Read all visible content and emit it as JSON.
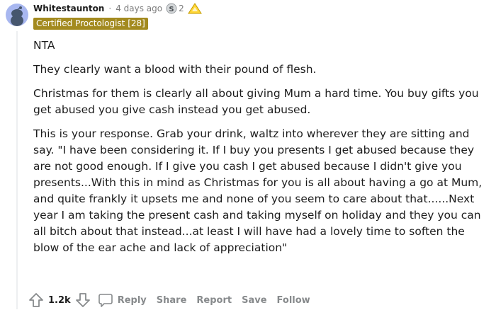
{
  "comment": {
    "username": "Whitestaunton",
    "separator": "·",
    "time": "4 days ago",
    "award_count": "2",
    "flair": "Certified Proctologist [28]",
    "paragraphs": [
      "NTA",
      "They clearly want a blood with their pound of flesh.",
      "Christmas for them is clearly all about giving Mum a hard time. You buy gifts you get abused you give cash instead you get abused.",
      "This is your response. Grab your drink, waltz into wherever they are sitting and say. \"I have been considering it. If I buy you presents I get abused because they are not good enough. If I give you cash I get abused because I didn't give you presents...With this in mind as Christmas for you is all about having a go at Mum, and quite frankly it upsets me and none of you seem to care about that......Next year I am taking the present cash and taking myself on holiday and they you can all bitch about that instead...at least I will have had a lovely time to soften the blow of the ear ache and lack of appreciation\""
    ]
  },
  "actions": {
    "score": "1.2k",
    "reply": "Reply",
    "share": "Share",
    "report": "Report",
    "save": "Save",
    "follow": "Follow"
  },
  "icons": {
    "avatar": "snoo-avatar-icon",
    "award1": "silver-award-icon",
    "award2": "helpful-award-icon",
    "upvote": "upvote-arrow-icon",
    "downvote": "downvote-arrow-icon",
    "reply": "comment-bubble-icon"
  },
  "colors": {
    "flair_bg": "#a38a1f",
    "avatar_bg": "#a8b7f0",
    "muted": "#878a8c"
  }
}
